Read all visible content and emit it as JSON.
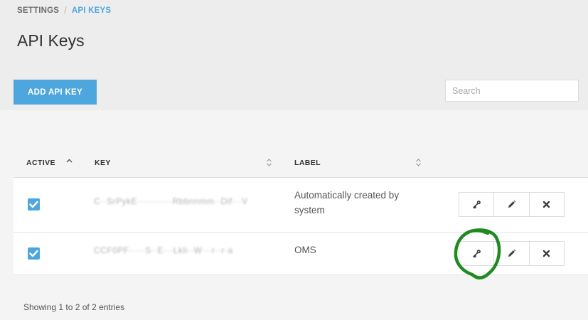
{
  "breadcrumb": {
    "parent": "SETTINGS",
    "separator": "/",
    "current": "API KEYS"
  },
  "page": {
    "title": "API Keys"
  },
  "toolbar": {
    "add_label": "ADD API KEY",
    "search_placeholder": "Search"
  },
  "table": {
    "headers": {
      "active": "ACTIVE",
      "key": "KEY",
      "label": "LABEL"
    },
    "rows": [
      {
        "active": true,
        "key": "C··SrPykE···········Rbbnnmm··Dif···V",
        "label": "Automatically created by system"
      },
      {
        "active": true,
        "key": "CCF0PF·····S··E···Lkli··W···r··r·a",
        "label": "OMS"
      }
    ]
  },
  "footer": {
    "info": "Showing 1 to 2 of 2 entries"
  },
  "icons": {
    "key": "key-icon",
    "edit": "pencil-icon",
    "delete": "close-icon",
    "check": "check-icon",
    "sort_asc": "caret-up-icon",
    "sort_both": "sort-icon"
  },
  "colors": {
    "accent": "#4ea7dc",
    "annotation": "#1f8a1f"
  }
}
